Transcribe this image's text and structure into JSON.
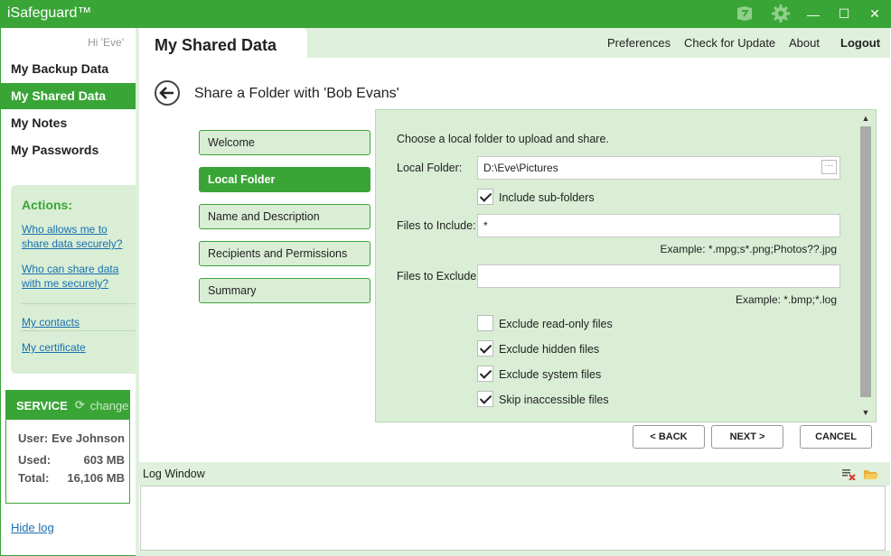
{
  "window": {
    "title": "iSafeguard™",
    "icons": {
      "tutorial": "tutorial-icon",
      "settings": "gear-icon"
    },
    "controls": {
      "minimize": "—",
      "maximize": "☐",
      "close": "✕"
    }
  },
  "sidebar": {
    "greeting": "Hi 'Eve'",
    "nav": [
      {
        "label": "My Backup Data",
        "active": false
      },
      {
        "label": "My Shared Data",
        "active": true
      },
      {
        "label": "My Notes",
        "active": false
      },
      {
        "label": "My Passwords",
        "active": false
      }
    ],
    "actions": {
      "title": "Actions:",
      "links": [
        "Who allows me to share data securely?",
        "Who can share data with me securely?",
        "My contacts",
        "My certificate"
      ]
    },
    "service": {
      "title": "SERVICE",
      "change": "change",
      "user_label": "User:",
      "user_value": "Eve Johnson",
      "used_label": "Used:",
      "used_value": "603 MB",
      "total_label": "Total:",
      "total_value": "16,106 MB"
    },
    "hide_log": "Hide log"
  },
  "header": {
    "page_title": "My Shared Data",
    "links": [
      "Preferences",
      "Check for Update",
      "About",
      "Logout"
    ]
  },
  "wizard": {
    "title": "Share a Folder with 'Bob Evans'",
    "steps": [
      {
        "label": "Welcome",
        "active": false
      },
      {
        "label": "Local Folder",
        "active": true
      },
      {
        "label": "Name and Description",
        "active": false
      },
      {
        "label": "Recipients and Permissions",
        "active": false
      },
      {
        "label": "Summary",
        "active": false
      }
    ],
    "panel": {
      "intro": "Choose a local folder to upload and share.",
      "local_folder_label": "Local Folder:",
      "local_folder_value": "D:\\Eve\\Pictures",
      "browse": "···",
      "include_sub": "Include sub-folders",
      "files_include_label": "Files to Include:",
      "files_include_value": "*",
      "include_example": "Example: *.mpg;s*.png;Photos??.jpg",
      "files_exclude_label": "Files to Exclude:",
      "files_exclude_value": "",
      "exclude_example": "Example: *.bmp;*.log",
      "options": [
        {
          "label": "Exclude read-only files",
          "checked": false
        },
        {
          "label": "Exclude hidden files",
          "checked": true
        },
        {
          "label": "Exclude system files",
          "checked": true
        },
        {
          "label": "Skip inaccessible files",
          "checked": true
        }
      ]
    },
    "buttons": {
      "back": "< BACK",
      "next": "NEXT >",
      "cancel": "CANCEL"
    }
  },
  "log": {
    "title": "Log Window",
    "icons": {
      "clear": "clear-log-icon",
      "open": "open-folder-icon"
    }
  }
}
